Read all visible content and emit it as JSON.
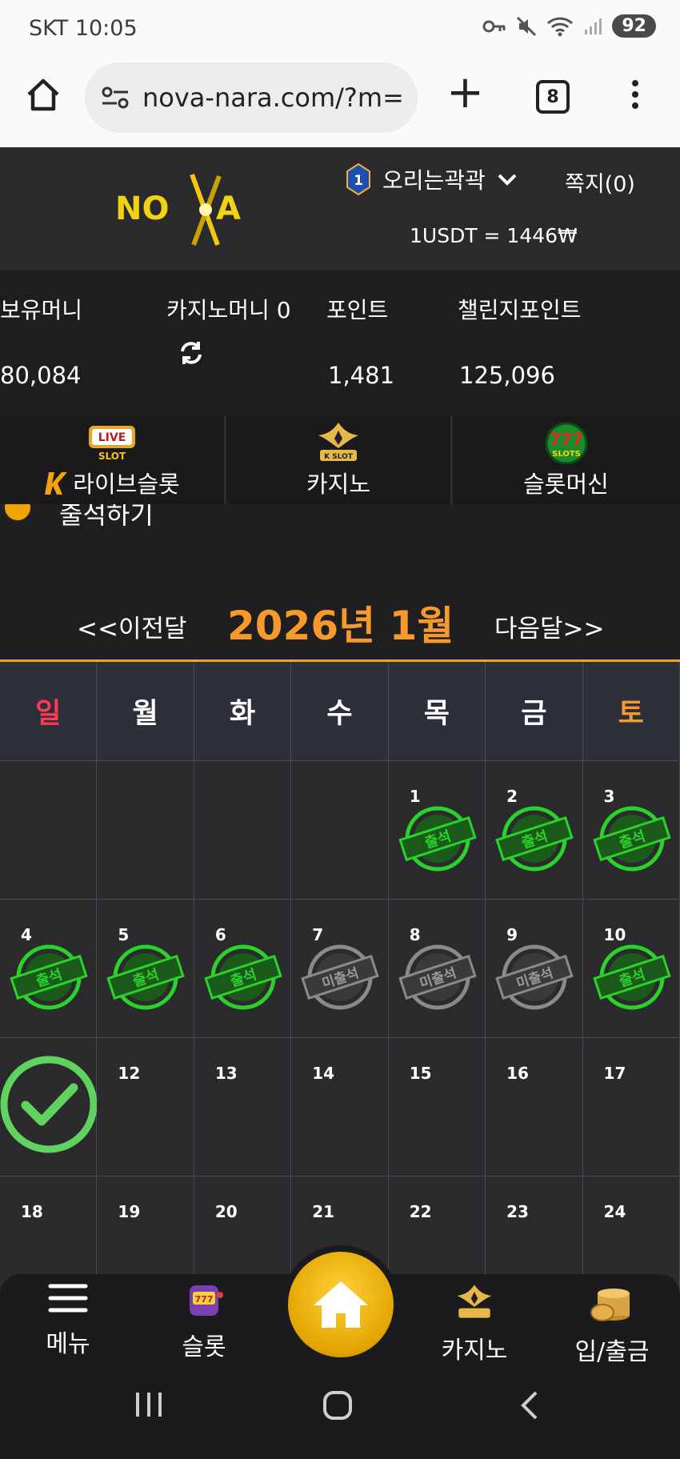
{
  "status_bar": {
    "carrier_time": "SKT 10:05",
    "battery": "92"
  },
  "browser": {
    "url": "nova-nara.com/?m=",
    "tab_count": "8"
  },
  "header": {
    "logo_text": "NOVA",
    "user_level": "1",
    "username": "오리는곽곽",
    "messages": "쪽지(0)",
    "rate": "1USDT = 1446₩"
  },
  "balances": {
    "money_label": "보유머니",
    "money_value": "80,084",
    "casino_label": "카지노머니 0",
    "point_label": "포인트",
    "point_value": "1,481",
    "challenge_label": "챌린지포인트",
    "challenge_value": "125,096"
  },
  "game_tabs": [
    {
      "label": "라이브슬롯",
      "icon": "live-slot-icon"
    },
    {
      "label": "카지노",
      "icon": "k-slot-icon"
    },
    {
      "label": "슬롯머신",
      "icon": "777-slots-icon"
    }
  ],
  "attendance": {
    "heading": "출석하기",
    "prev": "<<이전달",
    "month_title": "2026년 1월",
    "next": "다음달>>",
    "weekdays": [
      "일",
      "월",
      "화",
      "수",
      "목",
      "금",
      "토"
    ],
    "stamp_present": "출석",
    "stamp_absent": "미출석",
    "colors": {
      "sunday": "#ff3b52",
      "saturday": "#f79a2b",
      "present": "#29d329",
      "absent": "#8a8a8a",
      "accent": "#f0a030"
    }
  },
  "bottom_nav": {
    "menu": "메뉴",
    "slot": "슬롯",
    "casino": "카지노",
    "deposit": "입/출금"
  }
}
